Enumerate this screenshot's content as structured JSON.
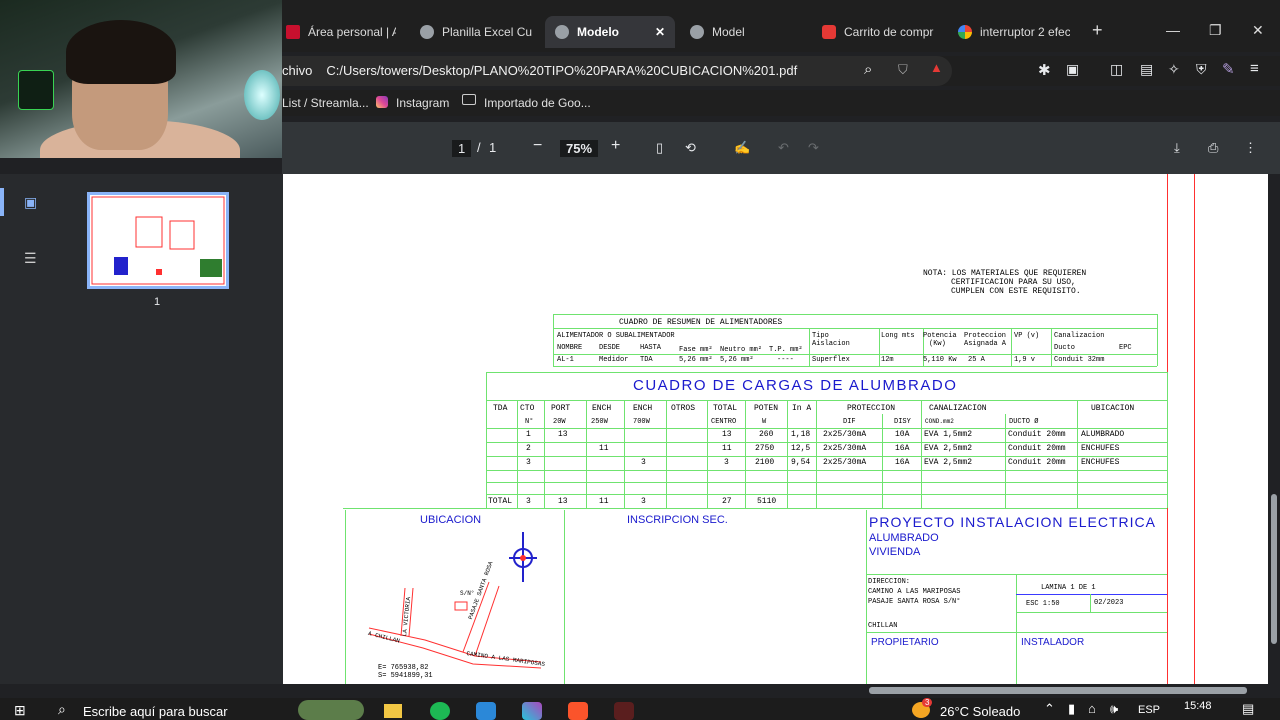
{
  "tabs": [
    {
      "label": "Área personal | A",
      "x_icon": "red-square-icon"
    },
    {
      "label": "Planilla Excel Cub",
      "x_icon": "globe-icon"
    },
    {
      "label": "Modelo",
      "x_icon": "globe-icon"
    },
    {
      "label": "Model",
      "x_icon": "globe-icon"
    },
    {
      "label": "Carrito de compr",
      "x_icon": "shop-icon"
    },
    {
      "label": "interruptor 2 efec",
      "x_icon": "google-icon"
    }
  ],
  "address": {
    "prefix": "chivo",
    "url": "C:/Users/towers/Desktop/PLANO%20TIPO%20PARA%20CUBICACION%201.pdf"
  },
  "bookmarks": [
    "List / Streamla...",
    "Instagram",
    "Importado de Goo..."
  ],
  "pdf_toolbar": {
    "page_current": "1",
    "page_sep": "/",
    "page_total": "1",
    "zoom": "75%"
  },
  "thumbnail": {
    "page_label": "1"
  },
  "drawing": {
    "nota": [
      "NOTA: LOS MATERIALES QUE REQUIEREN",
      "CERTIFICACION PARA SU USO,",
      "CUMPLEN CON ESTE REQUISITO."
    ],
    "resumen_title": "CUADRO DE RESUMEN DE ALIMENTADORES",
    "resumen_h1": [
      "ALIMENTADOR O SUBALIMENTADOR",
      "Tipo",
      "Long mts",
      "Potencia",
      "Proteccion",
      "VP (v)",
      "Canalizacion"
    ],
    "resumen_h1b": [
      "Aislacion",
      "(Kw)",
      "Asignada A"
    ],
    "resumen_h2": [
      "NOMBRE",
      "DESDE",
      "HASTA",
      "Fase mm²",
      "Neutro mm²",
      "T.P. mm²",
      "Ducto",
      "EPC"
    ],
    "resumen_row": [
      "AL-1",
      "Medidor",
      "TDA",
      "5,26 mm²",
      "5,26 mm²",
      "----",
      "Superflex",
      "12m",
      "5,110 Kw",
      "25 A",
      "1,9 v",
      "Conduit 32mm"
    ],
    "cargas_title": "CUADRO DE CARGAS DE ALUMBRADO",
    "cargas_h1": [
      "TDA",
      "CTO",
      "PORT",
      "ENCH",
      "ENCH",
      "OTROS",
      "TOTAL",
      "POTEN",
      "In A",
      "PROTECCION",
      "CANALIZACION",
      "UBICACION"
    ],
    "cargas_h2": [
      "N°",
      "20W",
      "250W",
      "700W",
      "CENTRO",
      "W",
      "DIF",
      "DISY",
      "COND.mm2",
      "DUCTO Ø"
    ],
    "cargas_rows": [
      [
        "1",
        "13",
        "",
        "",
        "13",
        "260",
        "1,18",
        "2x25/30mA",
        "10A",
        "EVA 1,5mm2",
        "Conduit 20mm",
        "ALUMBRADO"
      ],
      [
        "2",
        "",
        "11",
        "",
        "11",
        "2750",
        "12,5",
        "2x25/30mA",
        "16A",
        "EVA 2,5mm2",
        "Conduit 20mm",
        "ENCHUFES"
      ],
      [
        "3",
        "",
        "",
        "3",
        "3",
        "2100",
        "9,54",
        "2x25/30mA",
        "16A",
        "EVA 2,5mm2",
        "Conduit 20mm",
        "ENCHUFES"
      ]
    ],
    "total_row": [
      "TOTAL",
      "3",
      "13",
      "11",
      "3",
      "27",
      "5110"
    ],
    "ubicacion_title": "UBICACION",
    "map_labels": [
      "S/N°",
      "PASAJE SANTA ROSA",
      "LA VICTORIA",
      "A CHILLAN",
      "CAMINO A LAS MARIPOSAS"
    ],
    "coords": [
      "E= 765938,82",
      "S= 5941899,31"
    ],
    "inscripcion_title": "INSCRIPCION SEC.",
    "proyecto_title": "PROYECTO INSTALACION ELECTRICA",
    "proyecto_sub1": "ALUMBRADO",
    "proyecto_sub2": "VIVIENDA",
    "direccion": [
      "DIRECCION:",
      "CAMINO A LAS MARIPOSAS",
      "PASAJE SANTA ROSA S/N°"
    ],
    "ciudad": "CHILLAN",
    "lamina": "LAMINA 1 DE 1",
    "escala": "ESC 1:50",
    "fecha": "02/2023",
    "propietario": "PROPIETARIO",
    "instalador": "INSTALADOR"
  },
  "taskbar": {
    "search_placeholder": "Escribe aquí para buscar",
    "weather": "26°C Soleado",
    "lang": "ESP",
    "time": "15:48",
    "notif_count": "3"
  },
  "colors": {
    "cad_green": "#6fe36f",
    "cad_blue": "#1a1acd",
    "cad_red": "#ff3030"
  }
}
